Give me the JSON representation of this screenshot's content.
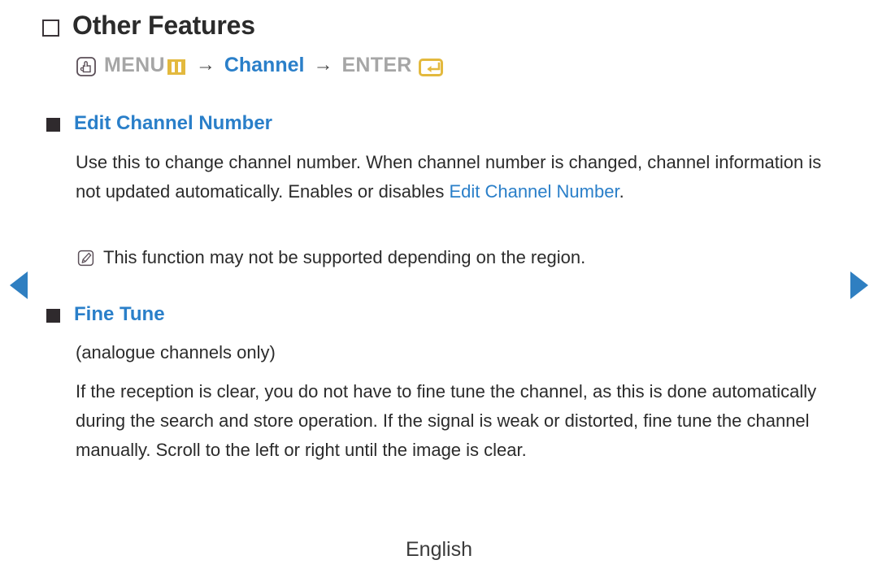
{
  "page": {
    "background": "#ffffff",
    "accent_blue": "#2a7fc9",
    "accent_gold": "#e3b93e",
    "text_gray": "#a6a6a6",
    "text_dark": "#2b2b2b"
  },
  "heading": {
    "icon": "square-outline-icon",
    "title": "Other Features"
  },
  "menu_path": {
    "hand_icon": "hand-press-button-icon",
    "menu_label": "MENU",
    "menu_icon": "menu-bars-icon",
    "arrow1": "→",
    "channel_label": "Channel",
    "arrow2": "→",
    "enter_label": "ENTER",
    "enter_icon": "enter-return-icon"
  },
  "sections": [
    {
      "bullet_icon": "square-filled-icon",
      "title": "Edit Channel Number",
      "paragraph_part1": "Use this to change channel number. When channel number is changed, channel information is not updated automatically. Enables or disables ",
      "paragraph_highlight": "Edit Channel Number",
      "paragraph_part2": ".",
      "note_icon": "note-pencil-icon",
      "note": "This function may not be supported depending on the region."
    },
    {
      "bullet_icon": "square-filled-icon",
      "title": "Fine Tune",
      "subtitle": "(analogue channels only)",
      "paragraph": "If the reception is clear, you do not have to fine tune the channel, as this is done automatically during the search and store operation. If the signal is weak or distorted, fine tune the channel manually. Scroll to the left or right until the image is clear."
    }
  ],
  "navigation": {
    "prev_icon": "arrow-left-icon",
    "next_icon": "arrow-right-icon"
  },
  "footer": {
    "language": "English"
  }
}
